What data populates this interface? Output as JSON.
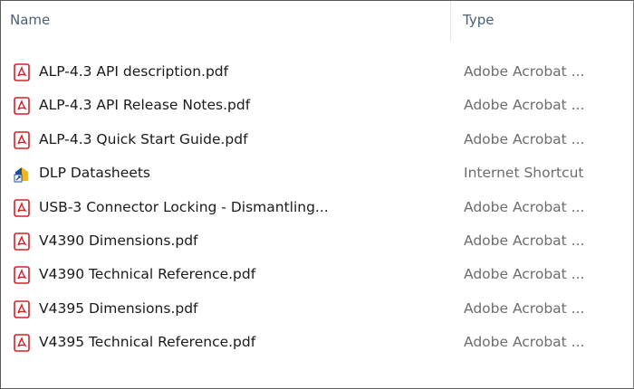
{
  "columns": {
    "name": "Name",
    "type": "Type"
  },
  "files": [
    {
      "name": "ALP-4.3 API description.pdf",
      "type": "Adobe Acrobat ...",
      "icon": "pdf-icon"
    },
    {
      "name": "ALP-4.3 API Release Notes.pdf",
      "type": "Adobe Acrobat ...",
      "icon": "pdf-icon"
    },
    {
      "name": "ALP-4.3 Quick Start Guide.pdf",
      "type": "Adobe Acrobat ...",
      "icon": "pdf-icon"
    },
    {
      "name": "DLP Datasheets",
      "type": "Internet Shortcut",
      "icon": "internet-shortcut-icon"
    },
    {
      "name": "USB-3 Connector Locking - Dismantling...",
      "type": "Adobe Acrobat ...",
      "icon": "pdf-icon"
    },
    {
      "name": "V4390 Dimensions.pdf",
      "type": "Adobe Acrobat ...",
      "icon": "pdf-icon"
    },
    {
      "name": "V4390 Technical Reference.pdf",
      "type": "Adobe Acrobat ...",
      "icon": "pdf-icon"
    },
    {
      "name": "V4395 Dimensions.pdf",
      "type": "Adobe Acrobat ...",
      "icon": "pdf-icon"
    },
    {
      "name": "V4395 Technical Reference.pdf",
      "type": "Adobe Acrobat ...",
      "icon": "pdf-icon"
    }
  ],
  "colors": {
    "header_text": "#4c607a",
    "type_text": "#6d6d6d",
    "pdf_red": "#d4202a",
    "shortcut_blue": "#1f4e9c",
    "shortcut_yellow": "#f2b51c"
  }
}
